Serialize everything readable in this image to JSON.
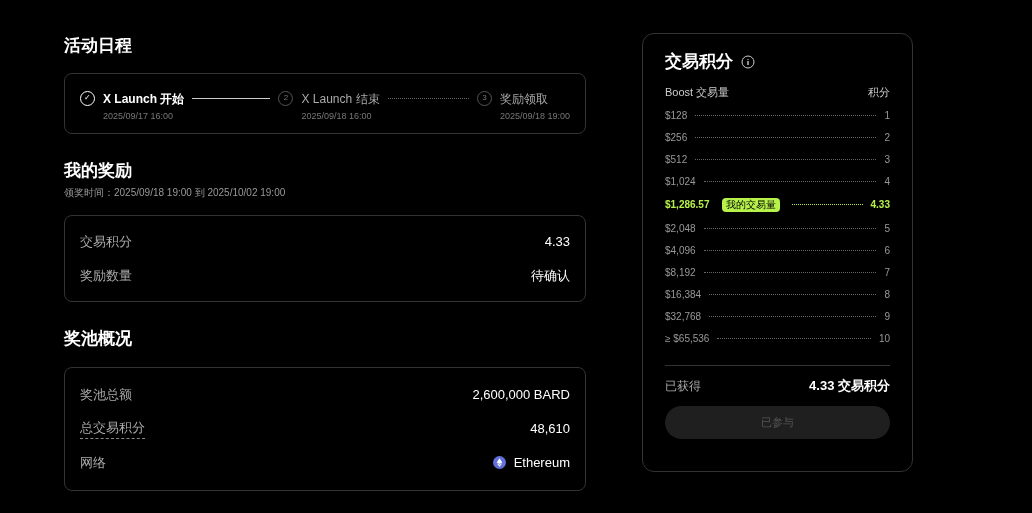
{
  "schedule": {
    "title": "活动日程",
    "steps": [
      {
        "marker": "✓",
        "label": "X Launch 开始",
        "time": "2025/09/17 16:00",
        "done": true
      },
      {
        "marker": "2",
        "label": "X Launch 结束",
        "time": "2025/09/18 16:00",
        "done": false
      },
      {
        "marker": "3",
        "label": "奖励领取",
        "time": "2025/09/18 19:00",
        "done": false
      }
    ]
  },
  "rewards": {
    "title": "我的奖励",
    "subtitle": "领奖时间：2025/09/18 19:00 到 2025/10/02 19:00",
    "rows": [
      {
        "label": "交易积分",
        "value": "4.33"
      },
      {
        "label": "奖励数量",
        "value": "待确认"
      }
    ]
  },
  "pool": {
    "title": "奖池概况",
    "rows": [
      {
        "kind": "plain",
        "label": "奖池总额",
        "value": "2,600,000 BARD"
      },
      {
        "kind": "underlined",
        "label": "总交易积分",
        "value": "48,610"
      },
      {
        "kind": "network",
        "label": "网络",
        "value": "Ethereum"
      }
    ]
  },
  "points": {
    "title": "交易积分",
    "col_volume": "Boost 交易量",
    "col_points": "积分",
    "tiers": [
      {
        "kind": "tier",
        "volume": "$128",
        "points": "1"
      },
      {
        "kind": "tier",
        "volume": "$256",
        "points": "2"
      },
      {
        "kind": "tier",
        "volume": "$512",
        "points": "3"
      },
      {
        "kind": "tier",
        "volume": "$1,024",
        "points": "4"
      },
      {
        "kind": "mine",
        "volume": "$1,286.57",
        "badge": "我的交易量",
        "points": "4.33"
      },
      {
        "kind": "tier",
        "volume": "$2,048",
        "points": "5"
      },
      {
        "kind": "tier",
        "volume": "$4,096",
        "points": "6"
      },
      {
        "kind": "tier",
        "volume": "$8,192",
        "points": "7"
      },
      {
        "kind": "tier",
        "volume": "$16,384",
        "points": "8"
      },
      {
        "kind": "tier",
        "volume": "$32,768",
        "points": "9"
      },
      {
        "kind": "tier",
        "volume": "≥ $65,536",
        "points": "10"
      }
    ],
    "earned_label": "已获得",
    "earned_value": "4.33 交易积分",
    "button": {
      "label": "已参与",
      "disabled": true
    }
  }
}
